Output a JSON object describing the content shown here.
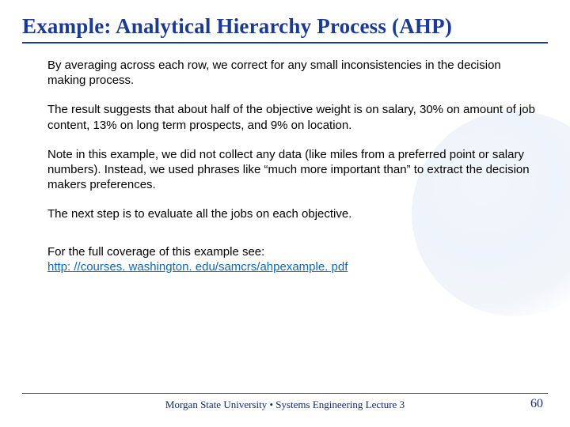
{
  "title": "Example: Analytical Hierarchy Process (AHP)",
  "paragraphs": {
    "p1": "By averaging across each row, we correct for any small inconsistencies in the decision making process.",
    "p2": "The result suggests that about half of the objective weight is on salary, 30% on amount of job content, 13% on long term prospects, and 9% on location.",
    "p3": "Note in this example, we did not collect any data (like miles from a preferred point or salary numbers). Instead, we used phrases like “much more important than” to extract the decision makers preferences.",
    "p4": "The next step is to evaluate all the jobs on each objective.",
    "p5a": "For the full coverage of this example see:",
    "p5b": "http: //courses. washington. edu/samcrs/ahpexample. pdf"
  },
  "footer": "Morgan State University  •  Systems Engineering Lecture 3",
  "page_number": "60"
}
